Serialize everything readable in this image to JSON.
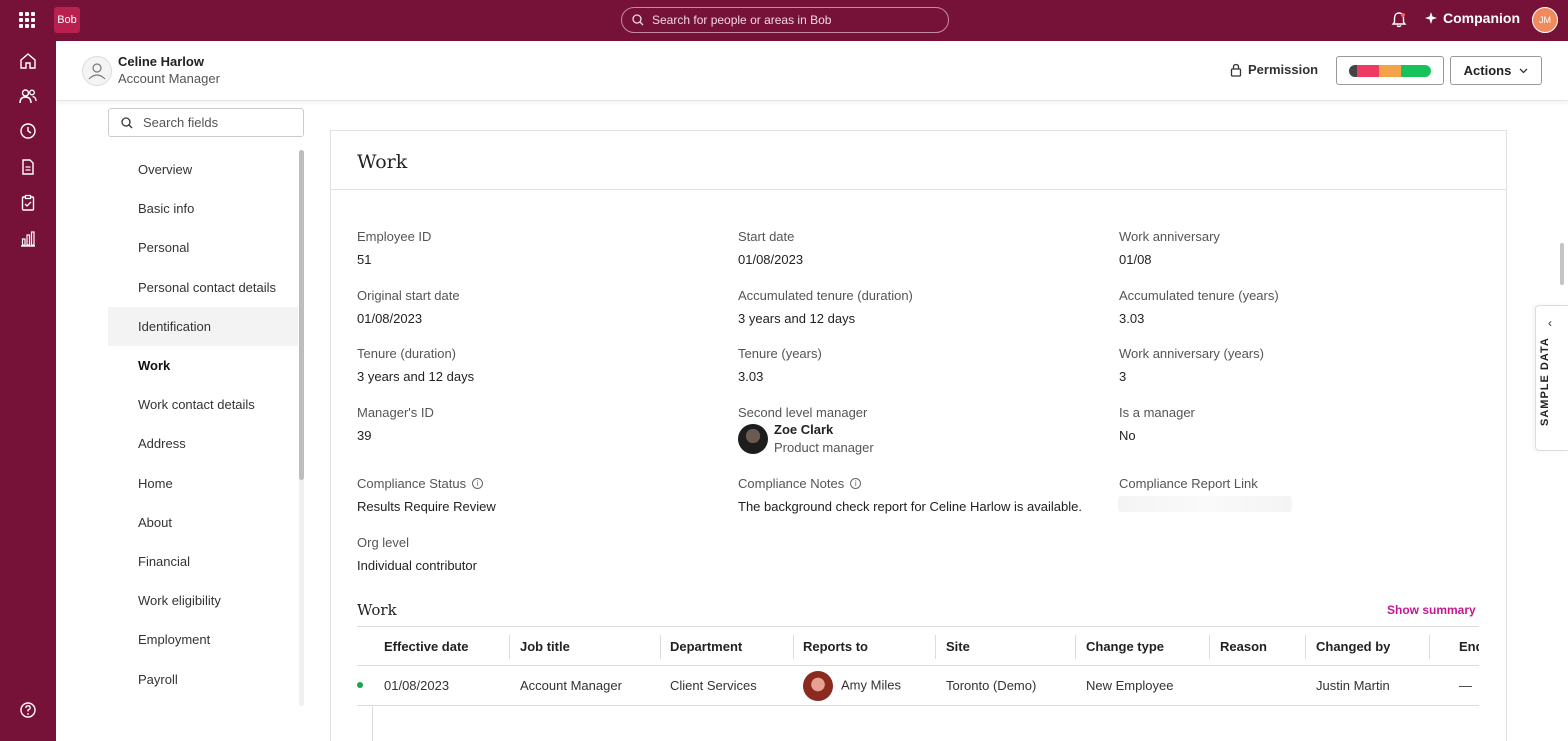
{
  "topbar": {
    "logo": "Bob",
    "search_placeholder": "Search for people or areas in Bob",
    "companion_label": "Companion",
    "user_initials": "JM"
  },
  "header": {
    "name": "Celine Harlow",
    "title": "Account Manager",
    "permission_label": "Permission",
    "actions_label": "Actions",
    "status_colors": [
      "#444444",
      "#ee3b63",
      "#f5a34a",
      "#17c25a"
    ]
  },
  "sidenav": {
    "search_placeholder": "Search fields",
    "items": [
      "Overview",
      "Basic info",
      "Personal",
      "Personal contact details",
      "Identification",
      "Work",
      "Work contact details",
      "Address",
      "Home",
      "About",
      "Financial",
      "Work eligibility",
      "Employment",
      "Payroll"
    ],
    "active": "Work"
  },
  "card": {
    "title": "Work",
    "fields": {
      "employee_id": {
        "label": "Employee ID",
        "value": "51"
      },
      "start_date": {
        "label": "Start date",
        "value": "01/08/2023"
      },
      "work_anniversary": {
        "label": "Work anniversary",
        "value": "01/08"
      },
      "original_start_date": {
        "label": "Original start date",
        "value": "01/08/2023"
      },
      "acc_tenure_duration": {
        "label": "Accumulated tenure (duration)",
        "value": "3 years and 12 days"
      },
      "acc_tenure_years": {
        "label": "Accumulated tenure (years)",
        "value": "3.03"
      },
      "tenure_duration": {
        "label": "Tenure (duration)",
        "value": "3 years and 12 days"
      },
      "tenure_years": {
        "label": "Tenure (years)",
        "value": "3.03"
      },
      "work_anniversary_years": {
        "label": "Work anniversary (years)",
        "value": "3"
      },
      "managers_id": {
        "label": "Manager's ID",
        "value": "39"
      },
      "second_level_manager": {
        "label": "Second level manager",
        "name": "Zoe Clark",
        "title": "Product manager"
      },
      "is_manager": {
        "label": "Is a manager",
        "value": "No"
      },
      "compliance_status": {
        "label": "Compliance Status",
        "value": "Results Require Review"
      },
      "compliance_notes": {
        "label": "Compliance Notes",
        "value": "The background check report for Celine Harlow is available."
      },
      "compliance_report_link": {
        "label": "Compliance Report Link"
      },
      "org_level": {
        "label": "Org level",
        "value": "Individual contributor"
      }
    },
    "work_section": {
      "title": "Work",
      "show_summary": "Show summary",
      "columns": [
        "Effective date",
        "Job title",
        "Department",
        "Reports to",
        "Site",
        "Change type",
        "Reason",
        "Changed by",
        "End eff"
      ],
      "rows": [
        {
          "effective_date": "01/08/2023",
          "job_title": "Account Manager",
          "department": "Client Services",
          "reports_to": "Amy Miles",
          "site": "Toronto (Demo)",
          "change_type": "New Employee",
          "reason": "",
          "changed_by": "Justin Martin",
          "end_effective": "—"
        }
      ]
    }
  },
  "sample_tab": {
    "label": "SAMPLE DATA"
  }
}
